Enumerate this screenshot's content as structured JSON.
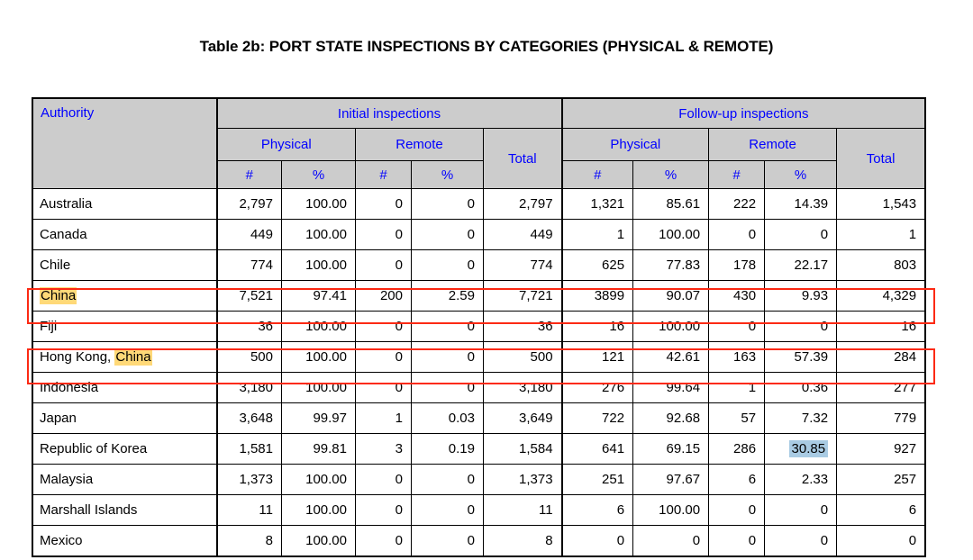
{
  "document": {
    "title": "Table 2b: PORT STATE INSPECTIONS BY CATEGORIES (PHYSICAL & REMOTE)"
  },
  "colors": {
    "header_background": "#cccccc",
    "header_text": "#0000ff",
    "annotation_rectangle": "#fc2a14",
    "yellow_highlight": "#ffd978",
    "blue_selection": "#a9cbe3",
    "body_text": "#000000",
    "page_background": "#ffffff"
  },
  "table": {
    "header": {
      "authority": "Authority",
      "group_initial": "Initial inspections",
      "group_followup": "Follow-up inspections",
      "sub_physical": "Physical",
      "sub_remote": "Remote",
      "sub_total": "Total",
      "unit_hash": "#",
      "unit_percent": "%"
    },
    "columns": [
      "Authority",
      "Initial Physical #",
      "Initial Physical %",
      "Initial Remote #",
      "Initial Remote %",
      "Initial Total",
      "Follow-up Physical #",
      "Follow-up Physical %",
      "Follow-up Remote #",
      "Follow-up Remote %",
      "Follow-up Total"
    ],
    "rows": [
      {
        "authority": "Australia",
        "authority_plain": "Australia",
        "authority_highlight": "",
        "init_phys_n": "2,797",
        "init_phys_p": "100.00",
        "init_rem_n": "0",
        "init_rem_p": "0",
        "init_total": "2,797",
        "fu_phys_n": "1,321",
        "fu_phys_p": "85.61",
        "fu_rem_n": "222",
        "fu_rem_p": "14.39",
        "fu_total": "1,543"
      },
      {
        "authority": "Canada",
        "authority_plain": "Canada",
        "authority_highlight": "",
        "init_phys_n": "449",
        "init_phys_p": "100.00",
        "init_rem_n": "0",
        "init_rem_p": "0",
        "init_total": "449",
        "fu_phys_n": "1",
        "fu_phys_p": "100.00",
        "fu_rem_n": "0",
        "fu_rem_p": "0",
        "fu_total": "1"
      },
      {
        "authority": "Chile",
        "authority_plain": "Chile",
        "authority_highlight": "",
        "init_phys_n": "774",
        "init_phys_p": "100.00",
        "init_rem_n": "0",
        "init_rem_p": "0",
        "init_total": "774",
        "fu_phys_n": "625",
        "fu_phys_p": "77.83",
        "fu_rem_n": "178",
        "fu_rem_p": "22.17",
        "fu_total": "803"
      },
      {
        "authority": "China",
        "authority_plain": "",
        "authority_highlight": "China",
        "init_phys_n": "7,521",
        "init_phys_p": "97.41",
        "init_rem_n": "200",
        "init_rem_p": "2.59",
        "init_total": "7,721",
        "fu_phys_n": "3899",
        "fu_phys_p": "90.07",
        "fu_rem_n": "430",
        "fu_rem_p": "9.93",
        "fu_total": "4,329"
      },
      {
        "authority": "Fiji",
        "authority_plain": "Fiji",
        "authority_highlight": "",
        "init_phys_n": "36",
        "init_phys_p": "100.00",
        "init_rem_n": "0",
        "init_rem_p": "0",
        "init_total": "36",
        "fu_phys_n": "16",
        "fu_phys_p": "100.00",
        "fu_rem_n": "0",
        "fu_rem_p": "0",
        "fu_total": "16"
      },
      {
        "authority": "Hong Kong, China",
        "authority_plain": "Hong Kong, ",
        "authority_highlight": "China",
        "init_phys_n": "500",
        "init_phys_p": "100.00",
        "init_rem_n": "0",
        "init_rem_p": "0",
        "init_total": "500",
        "fu_phys_n": "121",
        "fu_phys_p": "42.61",
        "fu_rem_n": "163",
        "fu_rem_p": "57.39",
        "fu_total": "284"
      },
      {
        "authority": "Indonesia",
        "authority_plain": "Indonesia",
        "authority_highlight": "",
        "init_phys_n": "3,180",
        "init_phys_p": "100.00",
        "init_rem_n": "0",
        "init_rem_p": "0",
        "init_total": "3,180",
        "fu_phys_n": "276",
        "fu_phys_p": "99.64",
        "fu_rem_n": "1",
        "fu_rem_p": "0.36",
        "fu_total": "277"
      },
      {
        "authority": "Japan",
        "authority_plain": "Japan",
        "authority_highlight": "",
        "init_phys_n": "3,648",
        "init_phys_p": "99.97",
        "init_rem_n": "1",
        "init_rem_p": "0.03",
        "init_total": "3,649",
        "fu_phys_n": "722",
        "fu_phys_p": "92.68",
        "fu_rem_n": "57",
        "fu_rem_p": "7.32",
        "fu_total": "779"
      },
      {
        "authority": "Republic of Korea",
        "authority_plain": "Republic of Korea",
        "authority_highlight": "",
        "init_phys_n": "1,581",
        "init_phys_p": "99.81",
        "init_rem_n": "3",
        "init_rem_p": "0.19",
        "init_total": "1,584",
        "fu_phys_n": "641",
        "fu_phys_p": "69.15",
        "fu_rem_n": "286",
        "fu_rem_p": "30.85",
        "fu_total": "927"
      },
      {
        "authority": "Malaysia",
        "authority_plain": "Malaysia",
        "authority_highlight": "",
        "init_phys_n": "1,373",
        "init_phys_p": "100.00",
        "init_rem_n": "0",
        "init_rem_p": "0",
        "init_total": "1,373",
        "fu_phys_n": "251",
        "fu_phys_p": "97.67",
        "fu_rem_n": "6",
        "fu_rem_p": "2.33",
        "fu_total": "257"
      },
      {
        "authority": "Marshall Islands",
        "authority_plain": "Marshall Islands",
        "authority_highlight": "",
        "init_phys_n": "11",
        "init_phys_p": "100.00",
        "init_rem_n": "0",
        "init_rem_p": "0",
        "init_total": "11",
        "fu_phys_n": "6",
        "fu_phys_p": "100.00",
        "fu_rem_n": "0",
        "fu_rem_p": "0",
        "fu_total": "6"
      },
      {
        "authority": "Mexico",
        "authority_plain": "Mexico",
        "authority_highlight": "",
        "init_phys_n": "8",
        "init_phys_p": "100.00",
        "init_rem_n": "0",
        "init_rem_p": "0",
        "init_total": "8",
        "fu_phys_n": "0",
        "fu_phys_p": "0",
        "fu_rem_n": "0",
        "fu_rem_p": "0",
        "fu_total": "0"
      }
    ]
  },
  "annotations": {
    "highlighted_rows": [
      "China",
      "Hong Kong, China"
    ],
    "selected_cell": {
      "row": "Republic of Korea",
      "column": "Follow-up Remote %",
      "value": "30.85"
    }
  }
}
